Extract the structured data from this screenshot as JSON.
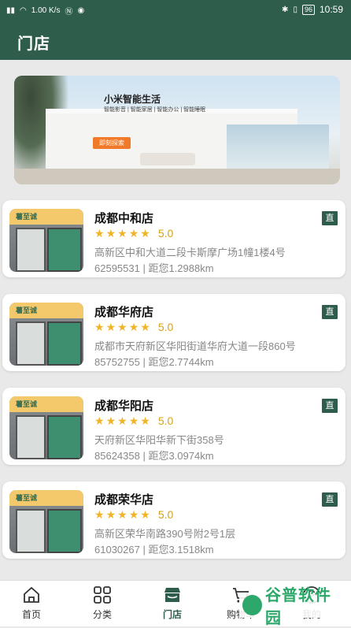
{
  "status_bar": {
    "left_icons": [
      "signal-icon",
      "wifi-icon",
      "nfc-icon",
      "notification-icon"
    ],
    "network_speed": "1.00 K/s",
    "battery": "96",
    "time": "10:59"
  },
  "header": {
    "title": "门店"
  },
  "banner": {
    "title": "小米智能生活",
    "subtitle": "智能影音 | 智能家居 | 智能办公 | 智能睡眠",
    "button": "即刻探索"
  },
  "stores": [
    {
      "name": "成都中和店",
      "badge": "直",
      "rating": "5.0",
      "address": "高新区中和大道二段卡斯摩广场1幢1楼4号",
      "meta": "62595531 | 距您1.2988km"
    },
    {
      "name": "成都华府店",
      "badge": "直",
      "rating": "5.0",
      "address": "成都市天府新区华阳街道华府大道一段860号",
      "meta": "85752755 | 距您2.7744km"
    },
    {
      "name": "成都华阳店",
      "badge": "直",
      "rating": "5.0",
      "address": "天府新区华阳华新下街358号",
      "meta": "85624358 | 距您3.0974km"
    },
    {
      "name": "成都荣华店",
      "badge": "直",
      "rating": "5.0",
      "address": "高新区荣华南路390号附2号1层",
      "meta": "61030267 | 距您3.1518km"
    }
  ],
  "store_photo_sign": "薯至诚",
  "bottom_nav": [
    {
      "label": "首页",
      "icon": "home-icon"
    },
    {
      "label": "分类",
      "icon": "grid-icon"
    },
    {
      "label": "门店",
      "icon": "store-icon",
      "active": true
    },
    {
      "label": "购物车",
      "icon": "cart-icon"
    },
    {
      "label": "我的",
      "icon": "profile-icon"
    }
  ],
  "watermark": {
    "text": "谷普软件园"
  },
  "colors": {
    "primary": "#2e5d4c",
    "star": "#f0b428",
    "rating_text": "#d4a21c",
    "background": "#e9e9e9"
  }
}
